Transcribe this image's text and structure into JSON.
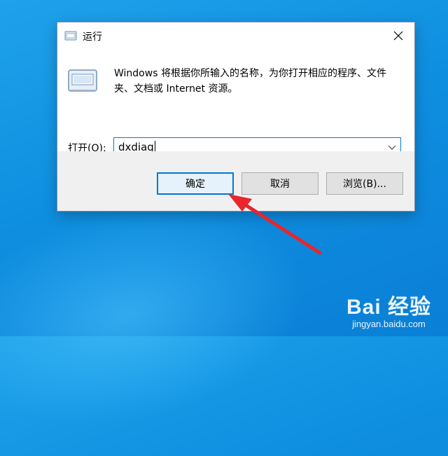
{
  "window": {
    "title": "运行",
    "close_icon": "close-icon"
  },
  "dialog": {
    "description": "Windows 将根据你所输入的名称，为你打开相应的程序、文件夹、文档或 Internet 资源。",
    "open_label": "打开(O):",
    "input_value": "dxdiag"
  },
  "buttons": {
    "ok": "确定",
    "cancel": "取消",
    "browse": "浏览(B)..."
  },
  "watermark": {
    "brand": "Bai 经验",
    "url": "jingyan.baidu.com"
  },
  "colors": {
    "accent": "#0078d7",
    "annotation_arrow": "#e8262b"
  }
}
